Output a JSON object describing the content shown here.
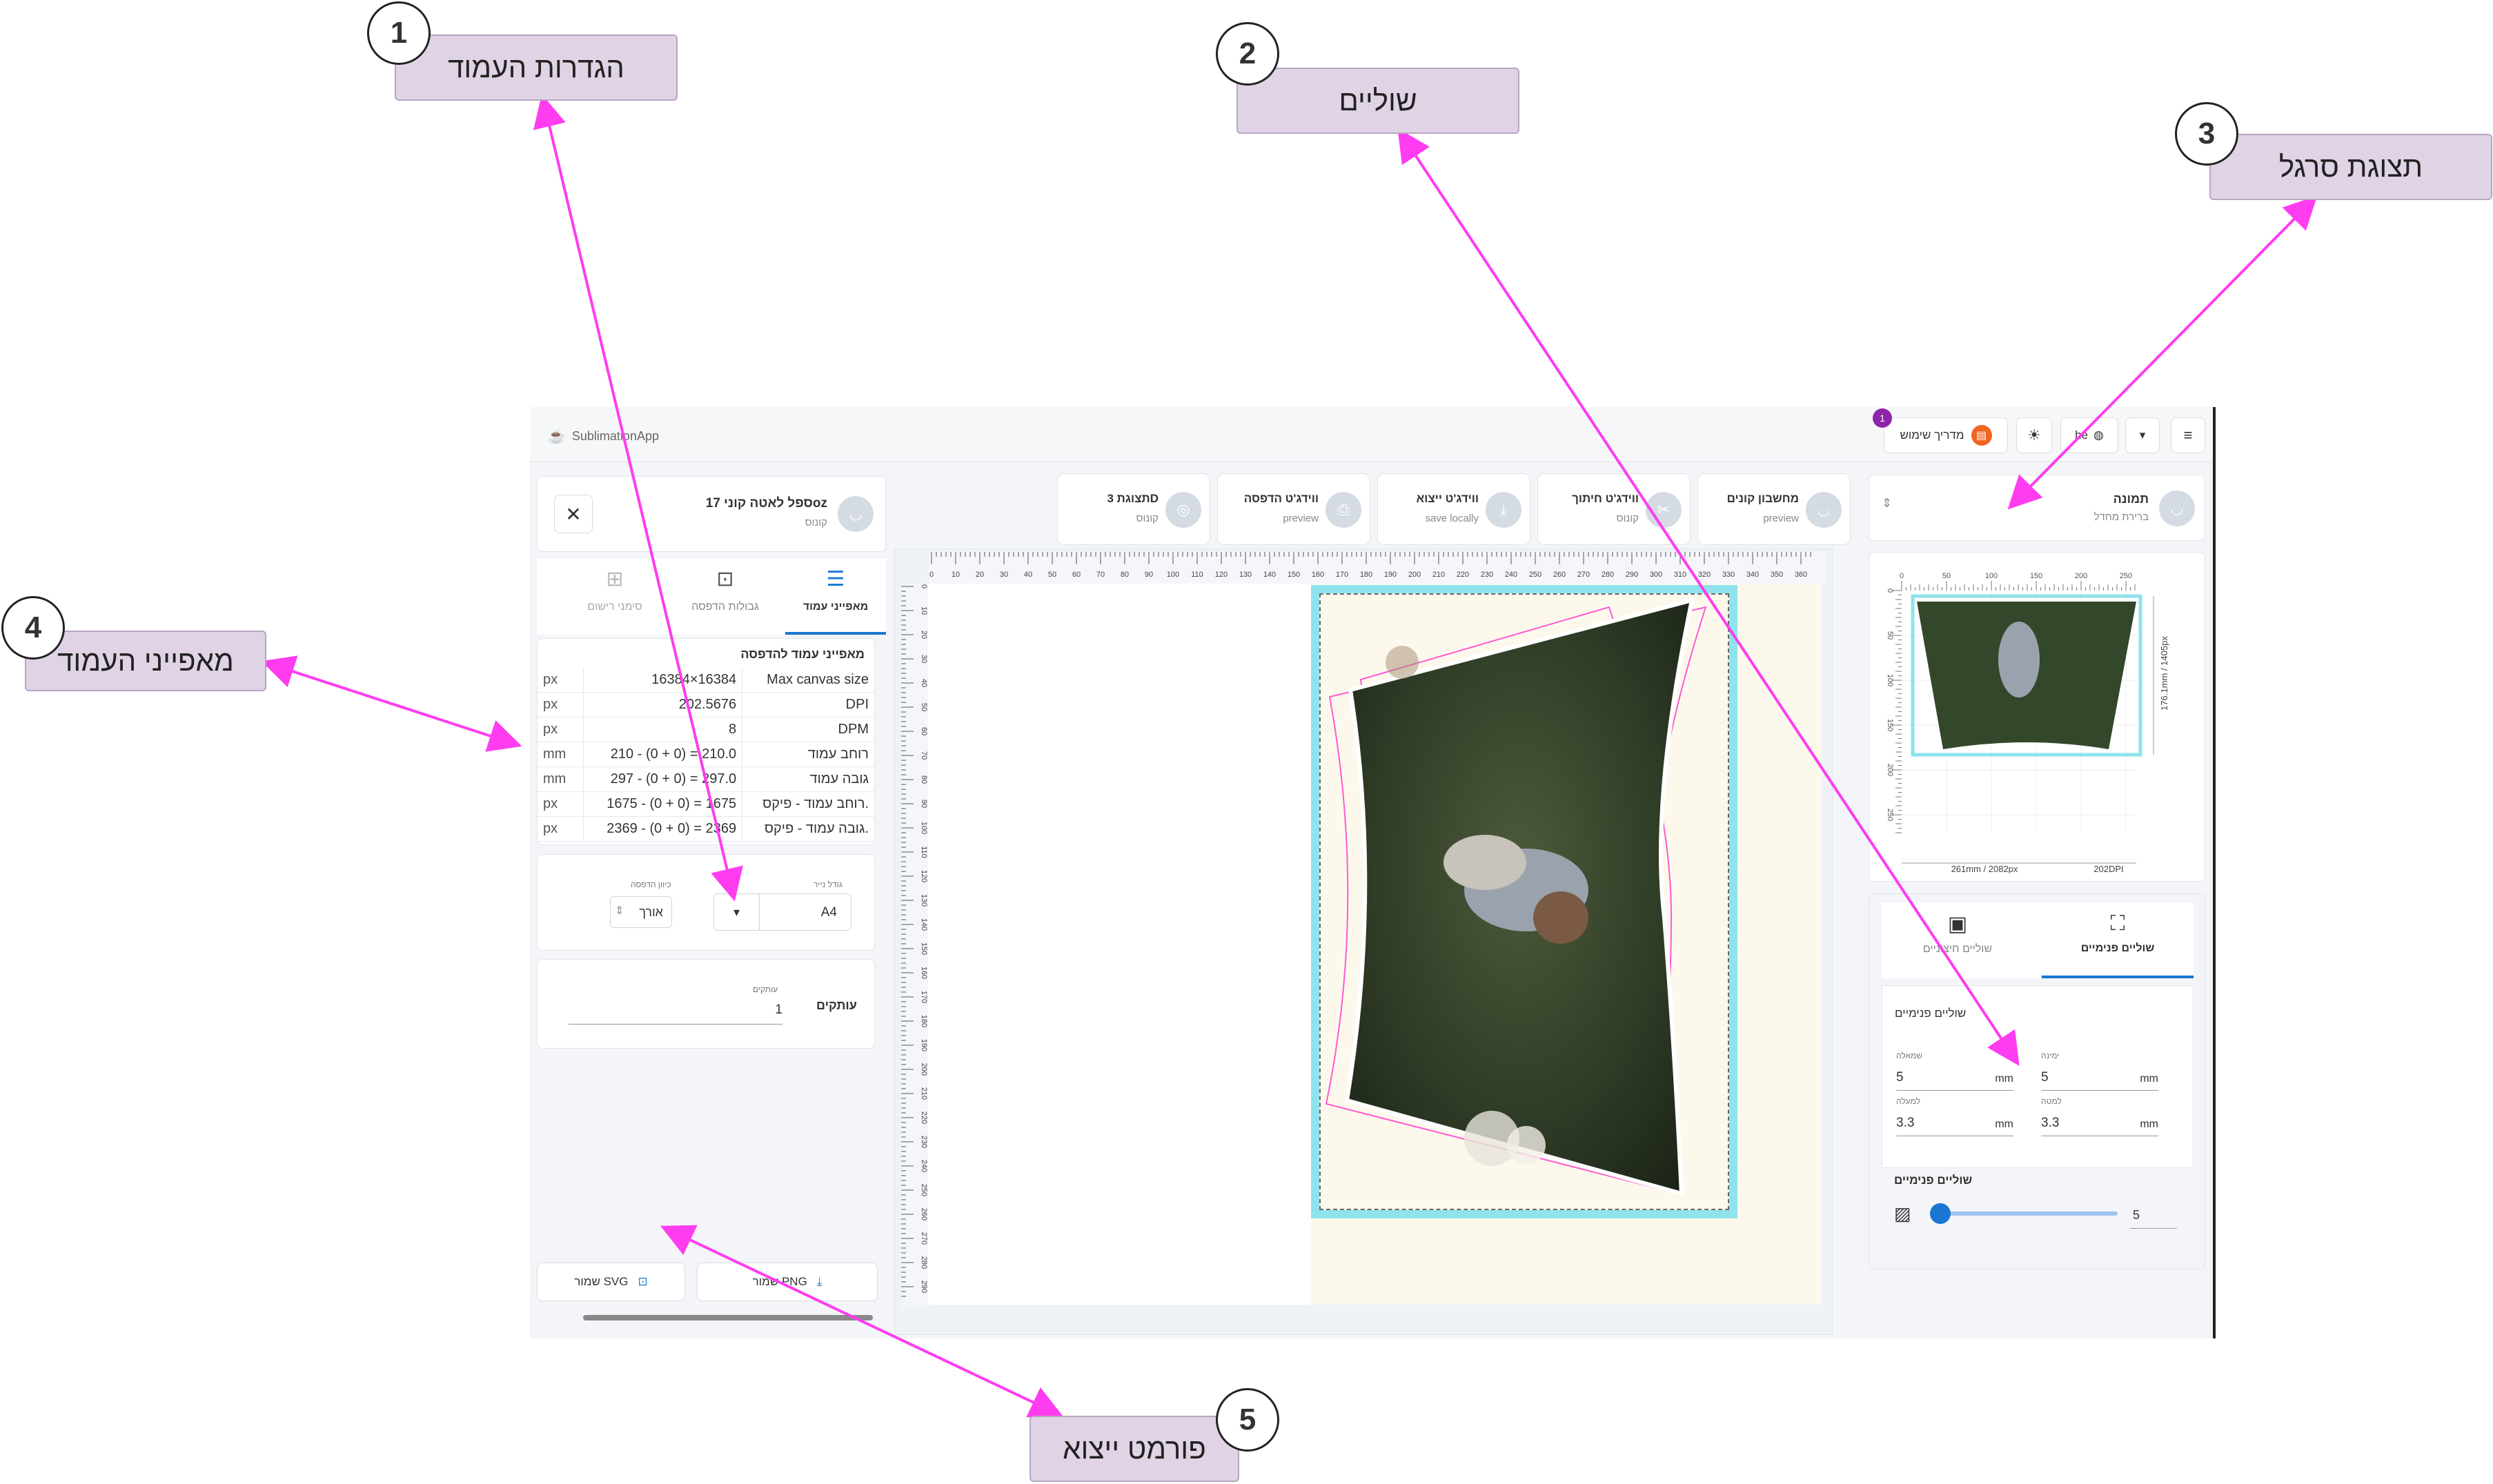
{
  "app": {
    "brand": "SublimationApp",
    "user_guide": "מדריך שימוש",
    "notification_count": "1",
    "language": "he"
  },
  "left_panel": {
    "product_title": "ספל לאטה קוני 17oz",
    "product_subtitle": "קונוס",
    "tabs": [
      {
        "label": "מאפייני עמוד"
      },
      {
        "label": "גבולות הדפסה"
      },
      {
        "label": "סימני רישום"
      }
    ],
    "section_title": "מאפייני עמוד להדפסה",
    "rows": [
      {
        "name": "Max canvas size",
        "value": "16384×16384",
        "unit": "px"
      },
      {
        "name": "DPI",
        "value": "202.5676",
        "unit": "px"
      },
      {
        "name": "DPM",
        "value": "8",
        "unit": "px"
      },
      {
        "name": "רוחב עמוד",
        "value": "210 - (0 + 0) = 210.0",
        "unit": "mm"
      },
      {
        "name": "גובה עמוד",
        "value": "297 - (0 + 0) = 297.0",
        "unit": "mm"
      },
      {
        "name": "רוחב עמוד - פיקס.",
        "value": "1675 - (0 + 0) = 1675",
        "unit": "px"
      },
      {
        "name": "גובה עמוד - פיקס.",
        "value": "2369 - (0 + 0) = 2369",
        "unit": "px"
      }
    ],
    "paper_size_label": "גודל נייר",
    "paper_size_value": "A4",
    "orientation_label": "כיוון הדפסה",
    "orientation_value": "אורך",
    "copies_title": "עותקים",
    "copies_label": "עותקים",
    "copies_value": "1",
    "save_svg": "שמור SVG",
    "save_png": "שמור PNG"
  },
  "widgets": [
    {
      "title": "מחשבון קונים",
      "subtitle": "preview"
    },
    {
      "title": "ווידג'ט חיתוך",
      "subtitle": "קונוס"
    },
    {
      "title": "ווידג'ט ייצוא",
      "subtitle": "save locally"
    },
    {
      "title": "ווידג'ט הדפסה",
      "subtitle": "preview"
    },
    {
      "title": "תצוגת 3D",
      "subtitle": "קונוס"
    }
  ],
  "ruler": {
    "top_ticks": [
      "0",
      "10",
      "20",
      "30",
      "40",
      "50",
      "60",
      "70",
      "80",
      "90",
      "100",
      "110",
      "120",
      "130",
      "140",
      "150",
      "160",
      "170",
      "180",
      "190",
      "200",
      "210",
      "220",
      "230",
      "240",
      "250",
      "260",
      "270",
      "280",
      "290",
      "300",
      "310",
      "320",
      "330",
      "340",
      "350",
      "360"
    ],
    "left_ticks": [
      "0",
      "10",
      "20",
      "30",
      "40",
      "50",
      "60",
      "70",
      "80",
      "90",
      "100",
      "110",
      "120",
      "130",
      "140",
      "150",
      "160",
      "170",
      "180",
      "190",
      "200",
      "210",
      "220",
      "230",
      "240",
      "250",
      "260",
      "270",
      "280",
      "290"
    ]
  },
  "right_panel": {
    "selector_title": "תמונה",
    "selector_subtitle": "ברירת מחדל",
    "mini_ticks_top": [
      "0",
      "50",
      "100",
      "150",
      "200",
      "250"
    ],
    "mini_ticks_left": [
      "0",
      "50",
      "100",
      "150",
      "200",
      "250"
    ],
    "mini_bottom_label": "261mm / 2082px",
    "mini_dpi": "202DPI",
    "mini_side_label": "176.1mm / 1405px",
    "tab_outer": "שוליים חיצוניים",
    "tab_inner": "שוליים פנימיים",
    "inner_title": "שוליים פנימיים",
    "right_label": "ימינה",
    "left_label": "שמאלה",
    "top_label": "למעלה",
    "bottom_label": "למטה",
    "right_value": "5",
    "left_value": "5",
    "top_value": "3.3",
    "bottom_value": "3.3",
    "unit": "mm",
    "slider_title": "שוליים פנימיים",
    "slider_value": "5",
    "slider_fraction": 0.0
  },
  "annotations": [
    {
      "num": "1",
      "label": "הגדרות העמוד"
    },
    {
      "num": "2",
      "label": "שוליים"
    },
    {
      "num": "3",
      "label": "תצוגת סרגל"
    },
    {
      "num": "4",
      "label": "מאפייני העמוד"
    },
    {
      "num": "5",
      "label": "פורמט ייצוא"
    }
  ],
  "colors": {
    "annotation_arrow": "#ff3cf0",
    "accent": "#1976d2",
    "print_area": "#8ee3ec",
    "notification": "#8e24aa",
    "guide_orange": "#f26522"
  }
}
